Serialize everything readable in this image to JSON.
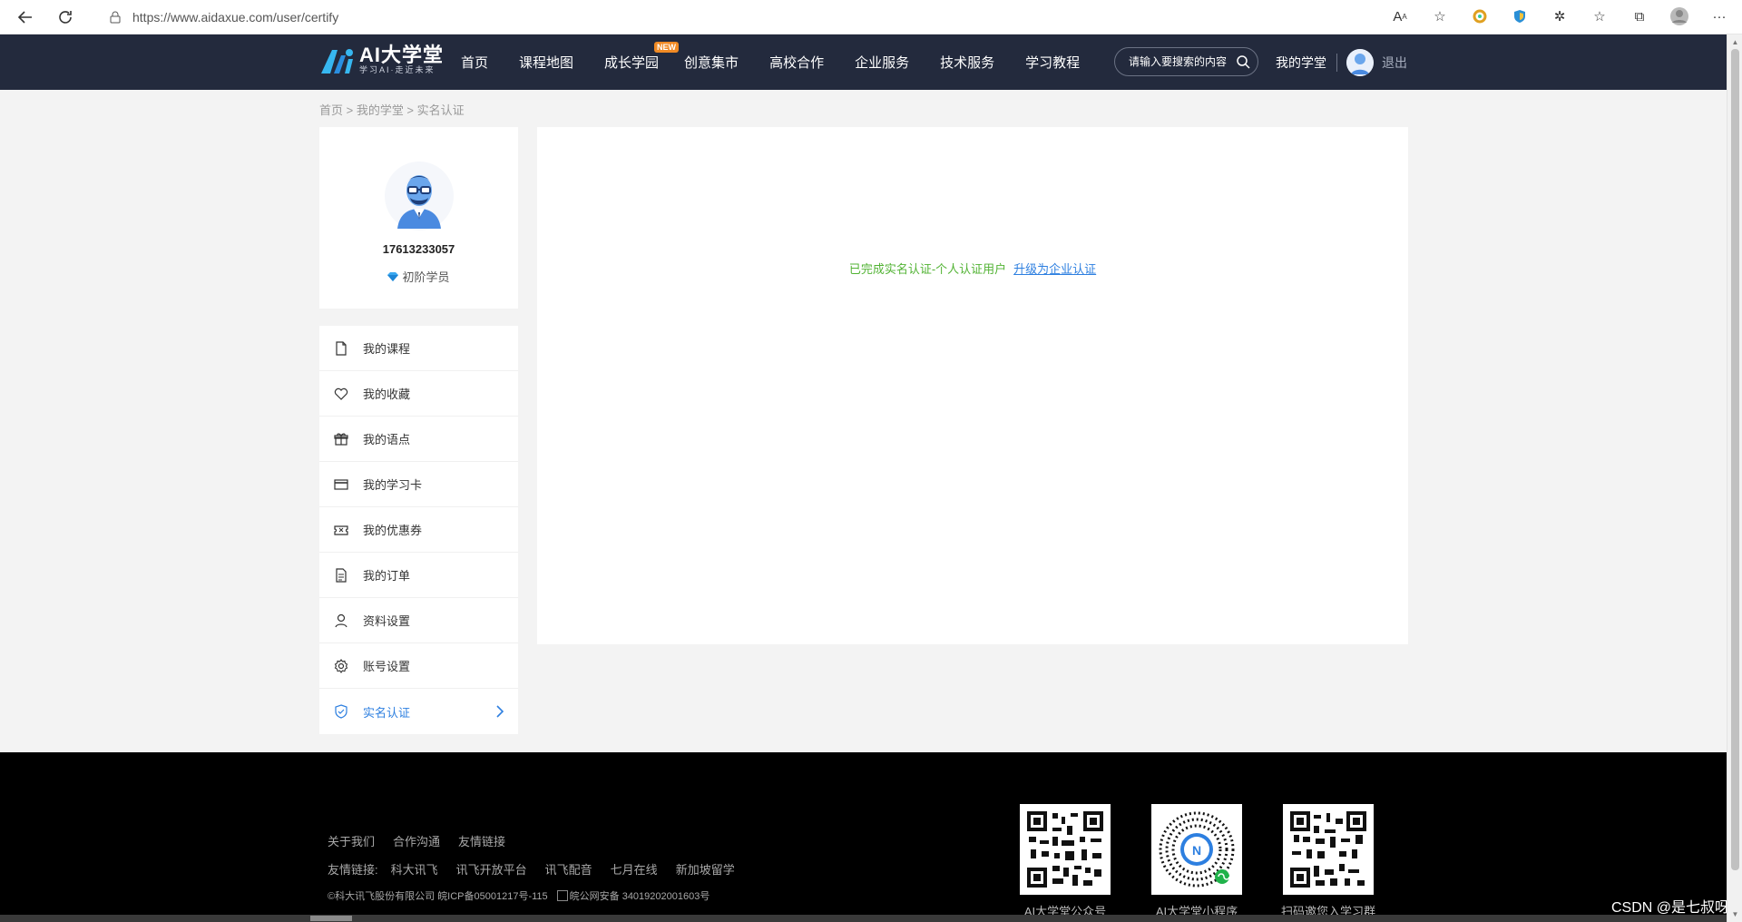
{
  "browser": {
    "url": "https://www.aidaxue.com/user/certify"
  },
  "header": {
    "logo_title": "AI大学堂",
    "logo_slogan": "学习AI·走近未来",
    "nav": [
      {
        "label": "首页"
      },
      {
        "label": "课程地图"
      },
      {
        "label": "成长学园",
        "badge": "NEW"
      },
      {
        "label": "创意集市"
      },
      {
        "label": "高校合作"
      },
      {
        "label": "企业服务"
      },
      {
        "label": "技术服务"
      },
      {
        "label": "学习教程"
      }
    ],
    "search_placeholder": "请输入要搜索的内容",
    "my_school": "我的学堂",
    "logout": "退出"
  },
  "breadcrumb": "首页 > 我的学堂 > 实名认证",
  "profile": {
    "user_id": "17613233057",
    "level": "初阶学员"
  },
  "menu": {
    "items": [
      {
        "label": "我的课程",
        "icon": "document-icon"
      },
      {
        "label": "我的收藏",
        "icon": "heart-icon"
      },
      {
        "label": "我的语点",
        "icon": "gift-icon"
      },
      {
        "label": "我的学习卡",
        "icon": "card-icon"
      },
      {
        "label": "我的优惠券",
        "icon": "ticket-icon"
      },
      {
        "label": "我的订单",
        "icon": "order-icon"
      },
      {
        "label": "资料设置",
        "icon": "user-icon"
      },
      {
        "label": "账号设置",
        "icon": "gear-icon"
      },
      {
        "label": "实名认证",
        "icon": "shield-icon",
        "active": true
      }
    ]
  },
  "content": {
    "status": "已完成实名认证-个人认证用户",
    "upgrade_link": "升级为企业认证"
  },
  "footer": {
    "links": [
      "关于我们",
      "合作沟通",
      "友情链接"
    ],
    "friends_label": "友情链接:",
    "friends": [
      "科大讯飞",
      "讯飞开放平台",
      "讯飞配音",
      "七月在线",
      "新加坡留学"
    ],
    "copyright": "©科大讯飞股份有限公司 皖ICP备05001217号-115",
    "police": "皖公网安备 34019202001603号",
    "qrcodes": [
      {
        "caption": "AI大学堂公众号"
      },
      {
        "caption": "AI大学堂小程序"
      },
      {
        "caption": "扫码邀您入学习群"
      }
    ]
  },
  "watermark": "CSDN @是七叔呀",
  "colors": {
    "header_bg": "#232a3d",
    "accent_blue": "#2d7fe0",
    "success_green": "#52b334",
    "footer_bg": "#000000",
    "page_bg": "#f3f3f3"
  }
}
